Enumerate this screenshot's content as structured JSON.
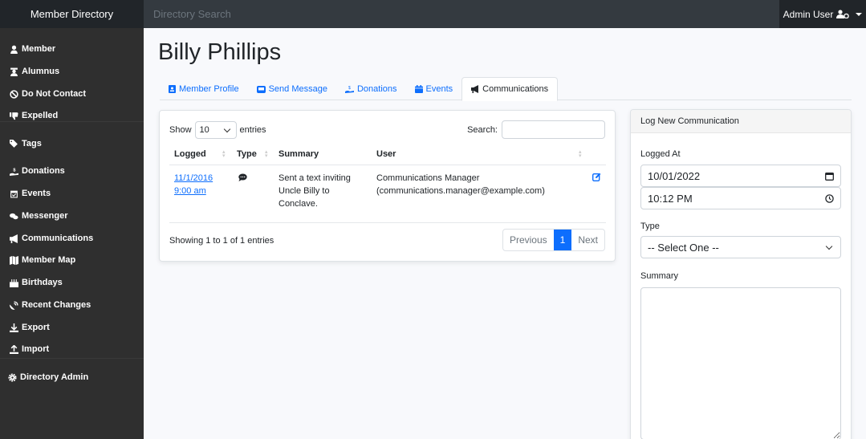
{
  "topbar": {
    "brand": "Member Directory",
    "search_placeholder": "Directory Search",
    "user": "Admin User"
  },
  "sidebar": {
    "groups": [
      [
        {
          "label": "Member",
          "icon": "user-icon"
        },
        {
          "label": "Alumnus",
          "icon": "graduate-icon"
        },
        {
          "label": "Do Not Contact",
          "icon": "ban-icon"
        },
        {
          "label": "Expelled",
          "icon": "thumbs-down-icon"
        }
      ],
      [
        {
          "label": "Tags",
          "icon": "tags-icon"
        }
      ],
      [
        {
          "label": "Donations",
          "icon": "hand-holding-dollar-icon"
        },
        {
          "label": "Events",
          "icon": "calendar-check-icon"
        },
        {
          "label": "Messenger",
          "icon": "comments-icon"
        },
        {
          "label": "Communications",
          "icon": "bullhorn-icon"
        },
        {
          "label": "Member Map",
          "icon": "map-icon"
        },
        {
          "label": "Birthdays",
          "icon": "birthday-cake-icon"
        },
        {
          "label": "Recent Changes",
          "icon": "satellite-dish-icon"
        },
        {
          "label": "Export",
          "icon": "download-icon"
        },
        {
          "label": "Import",
          "icon": "upload-icon"
        }
      ],
      [
        {
          "label": "Directory Admin",
          "icon": "gear-icon"
        }
      ]
    ]
  },
  "page": {
    "title": "Billy Phillips"
  },
  "tabs": [
    {
      "label": "Member Profile",
      "icon": "id-badge-icon",
      "active": false
    },
    {
      "label": "Send Message",
      "icon": "envelope-open-icon",
      "active": false
    },
    {
      "label": "Donations",
      "icon": "hand-holding-dollar-icon",
      "active": false
    },
    {
      "label": "Events",
      "icon": "calendar-icon",
      "active": false
    },
    {
      "label": "Communications",
      "icon": "bullhorn-icon",
      "active": true
    }
  ],
  "table": {
    "show_label": "Show",
    "entries_label": "entries",
    "page_length": "10",
    "search_label": "Search:",
    "search_value": "",
    "columns": [
      "Logged",
      "Type",
      "Summary",
      "User"
    ],
    "rows": [
      {
        "logged_date": "11/1/2016",
        "logged_time": "9:00 am",
        "type_icon": "sms-icon",
        "summary": "Sent a text inviting Uncle Billy to Conclave.",
        "user_name": "Communications Manager",
        "user_email": "(communications.manager@example.com)"
      }
    ],
    "info": "Showing 1 to 1 of 1 entries",
    "pagination": {
      "previous": "Previous",
      "current": "1",
      "next": "Next"
    }
  },
  "form": {
    "title": "Log New Communication",
    "logged_at_label": "Logged At",
    "date_value": "10/01/2022",
    "time_value": "10:12 PM",
    "type_label": "Type",
    "type_selected": "-- Select One --",
    "summary_label": "Summary",
    "summary_value": ""
  },
  "colors": {
    "accent": "#0d6efd",
    "sidebar_bg": "#2f2f2f",
    "topbar_bg": "#343a40"
  }
}
